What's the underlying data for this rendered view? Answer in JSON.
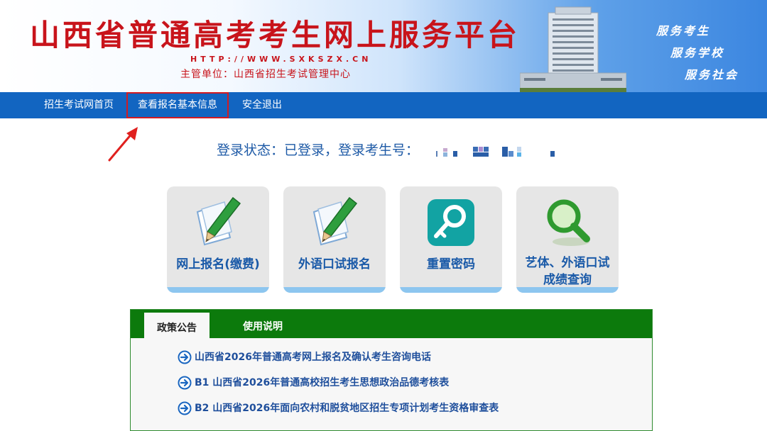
{
  "header": {
    "title": "山西省普通高考考生网上服务平台",
    "url": "HTTP://WWW.SXKSZX.CN",
    "sponsor": "主管单位：山西省招生考试管理中心",
    "slogans": [
      "服务考生",
      "服务学校",
      "服务社会"
    ]
  },
  "nav": {
    "items": [
      {
        "label": "招生考试网首页"
      },
      {
        "label": "查看报名基本信息"
      },
      {
        "label": "安全退出"
      }
    ],
    "highlighted_index": 1
  },
  "status": {
    "text": "登录状态：已登录，登录考生号："
  },
  "tiles": [
    {
      "label": "网上报名(缴费)",
      "icon": "paper-pencil-icon"
    },
    {
      "label": "外语口试报名",
      "icon": "paper-pencil-icon"
    },
    {
      "label": "重置密码",
      "icon": "key-icon"
    },
    {
      "label_line1": "艺体、外语口试",
      "label_line2": "成绩查询",
      "icon": "magnifier-icon"
    }
  ],
  "panel": {
    "tabs": [
      {
        "label": "政策公告",
        "active": true
      },
      {
        "label": "使用说明",
        "active": false
      }
    ],
    "notices": [
      {
        "text": "山西省2026年普通高考网上报名及确认考生咨询电话"
      },
      {
        "text": "B1 山西省2026年普通高校招生考生思想政治品德考核表"
      },
      {
        "text": "B2 山西省2026年面向农村和脱贫地区招生专项计划考生资格审查表"
      }
    ]
  },
  "colors": {
    "title_red": "#c8141b",
    "nav_blue": "#1265c1",
    "tab_green": "#0c7a0c",
    "link_blue": "#1f4f9c",
    "highlight_red": "#d21b22"
  }
}
